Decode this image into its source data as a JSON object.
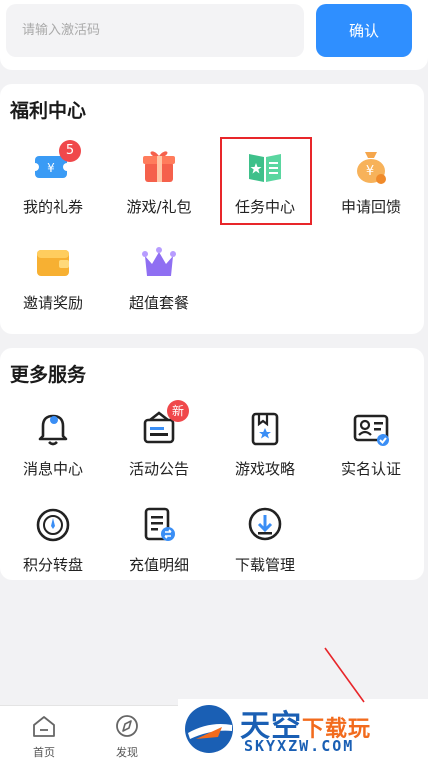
{
  "activation": {
    "placeholder": "请输入激活码",
    "confirm_label": "确认"
  },
  "welfare": {
    "title": "福利中心",
    "items": [
      {
        "label": "我的礼券",
        "icon": "ticket-icon",
        "badge": "5"
      },
      {
        "label": "游戏/礼包",
        "icon": "gift-box-icon"
      },
      {
        "label": "任务中心",
        "icon": "task-book-icon"
      },
      {
        "label": "申请回馈",
        "icon": "money-bag-icon"
      },
      {
        "label": "邀请奖励",
        "icon": "wallet-icon"
      },
      {
        "label": "超值套餐",
        "icon": "crown-package-icon"
      }
    ]
  },
  "services": {
    "title": "更多服务",
    "items": [
      {
        "label": "消息中心",
        "icon": "bell-icon"
      },
      {
        "label": "活动公告",
        "icon": "announcement-icon",
        "badge": "新"
      },
      {
        "label": "游戏攻略",
        "icon": "guide-book-icon"
      },
      {
        "label": "实名认证",
        "icon": "id-card-icon"
      },
      {
        "label": "积分转盘",
        "icon": "wheel-icon"
      },
      {
        "label": "充值明细",
        "icon": "recharge-record-icon"
      },
      {
        "label": "下载管理",
        "icon": "download-icon"
      }
    ]
  },
  "bottom_nav": {
    "tabs": [
      {
        "label": "首页",
        "icon": "home-icon"
      },
      {
        "label": "发现",
        "icon": "compass-icon"
      }
    ]
  },
  "watermark": {
    "text_main": "天空",
    "text_accent": "下载玩",
    "url": "SKYXZW.COM"
  },
  "colors": {
    "accent": "#2f8fff",
    "highlight": "#e8262a",
    "badge": "#f0484b"
  }
}
